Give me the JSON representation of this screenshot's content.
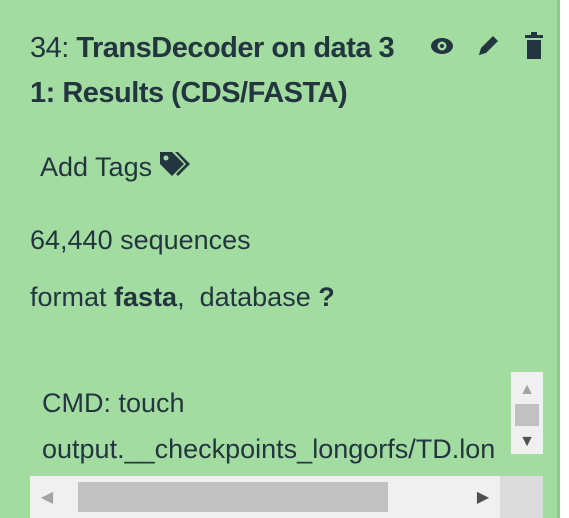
{
  "dataset": {
    "hid": "34:",
    "name": "TransDecoder on data 3\n1: Results (CDS/FASTA)",
    "actions": [
      {
        "name": "view",
        "icon": "eye-icon"
      },
      {
        "name": "edit",
        "icon": "pencil-icon"
      },
      {
        "name": "delete",
        "icon": "trash-icon"
      }
    ]
  },
  "tags": {
    "label": "Add Tags",
    "icon": "tags-icon"
  },
  "info": {
    "sequences": "64,440 sequences",
    "format_label": "format",
    "format_value": "fasta",
    "separator": ",",
    "database_label": "database",
    "database_value": "?"
  },
  "peek": {
    "lines": [
      "CMD: touch",
      "output.__checkpoints_longorfs/TD.lon"
    ]
  },
  "colors": {
    "panel_bg": "#a3dca1",
    "text": "#23363f"
  }
}
